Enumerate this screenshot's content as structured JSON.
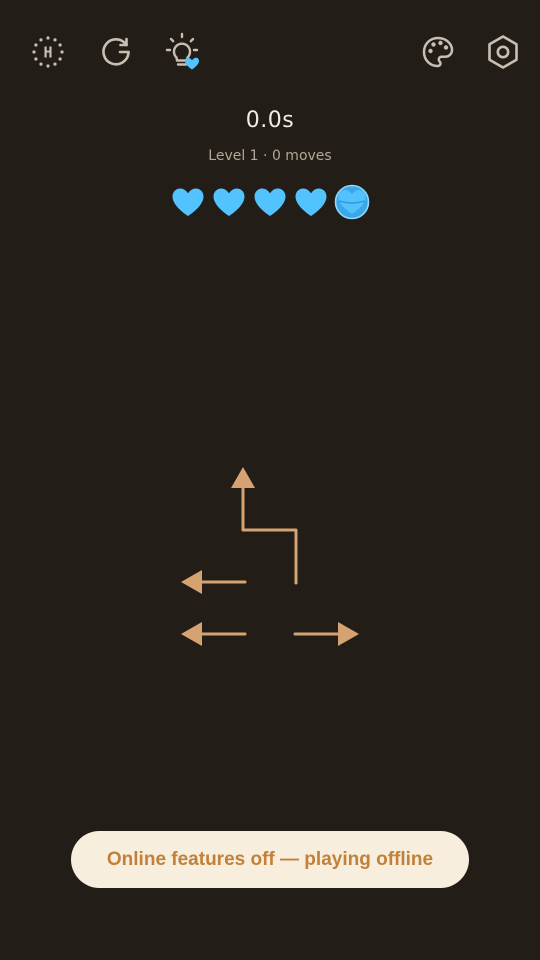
{
  "colors": {
    "background": "#231d17",
    "icon": "#c9bfb1",
    "arrow": "#d5a371",
    "heart": "#52c3ff",
    "heart_ring": "#8fd8ff",
    "toast_bg": "#f7eedd",
    "toast_text": "#c2813a"
  },
  "toolbar": {
    "left_icons": [
      "history-icon",
      "restart-icon",
      "hint-lightbulb-icon"
    ],
    "right_icons": [
      "palette-icon",
      "settings-hexagon-icon"
    ],
    "history_icon_letter": "H"
  },
  "hud": {
    "timer": "0.0s",
    "status": "Level 1 · 0 moves",
    "lives_total": 5,
    "lives_full": 4,
    "lives_active_index": 4
  },
  "board": {
    "arrows": [
      {
        "id": "arrow-bent-up",
        "direction": "up"
      },
      {
        "id": "arrow-left-upper",
        "direction": "left"
      },
      {
        "id": "arrow-left-lower",
        "direction": "left"
      },
      {
        "id": "arrow-right",
        "direction": "right"
      }
    ]
  },
  "toast": {
    "text": "Online features off — playing offline"
  }
}
